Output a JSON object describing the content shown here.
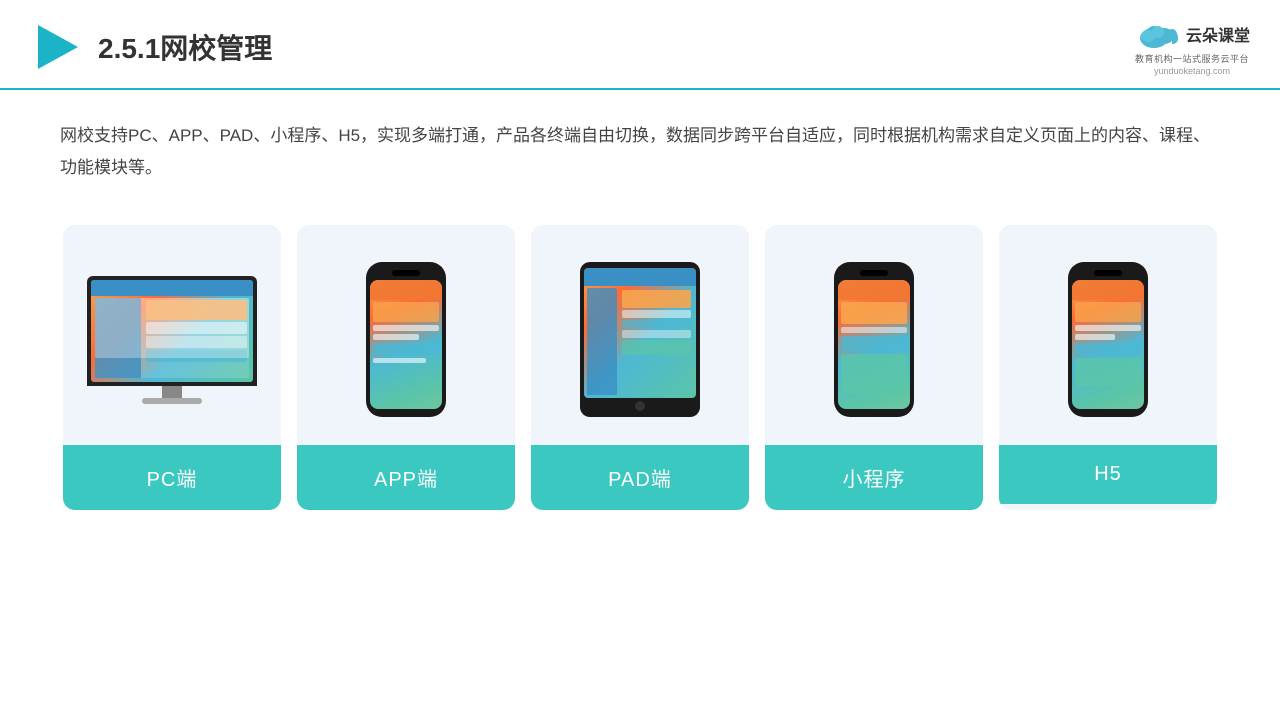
{
  "header": {
    "title": "2.5.1网校管理",
    "logo": {
      "name": "云朵课堂",
      "url": "yunduoketang.com",
      "tagline": "教育机构一站式服务云平台"
    }
  },
  "description": "网校支持PC、APP、PAD、小程序、H5，实现多端打通，产品各终端自由切换，数据同步跨平台自适应，同时根据机构需求自定义页面上的内容、课程、功能模块等。",
  "cards": [
    {
      "label": "PC端",
      "type": "pc"
    },
    {
      "label": "APP端",
      "type": "phone"
    },
    {
      "label": "PAD端",
      "type": "tablet"
    },
    {
      "label": "小程序",
      "type": "phone2"
    },
    {
      "label": "H5",
      "type": "phone3"
    }
  ]
}
